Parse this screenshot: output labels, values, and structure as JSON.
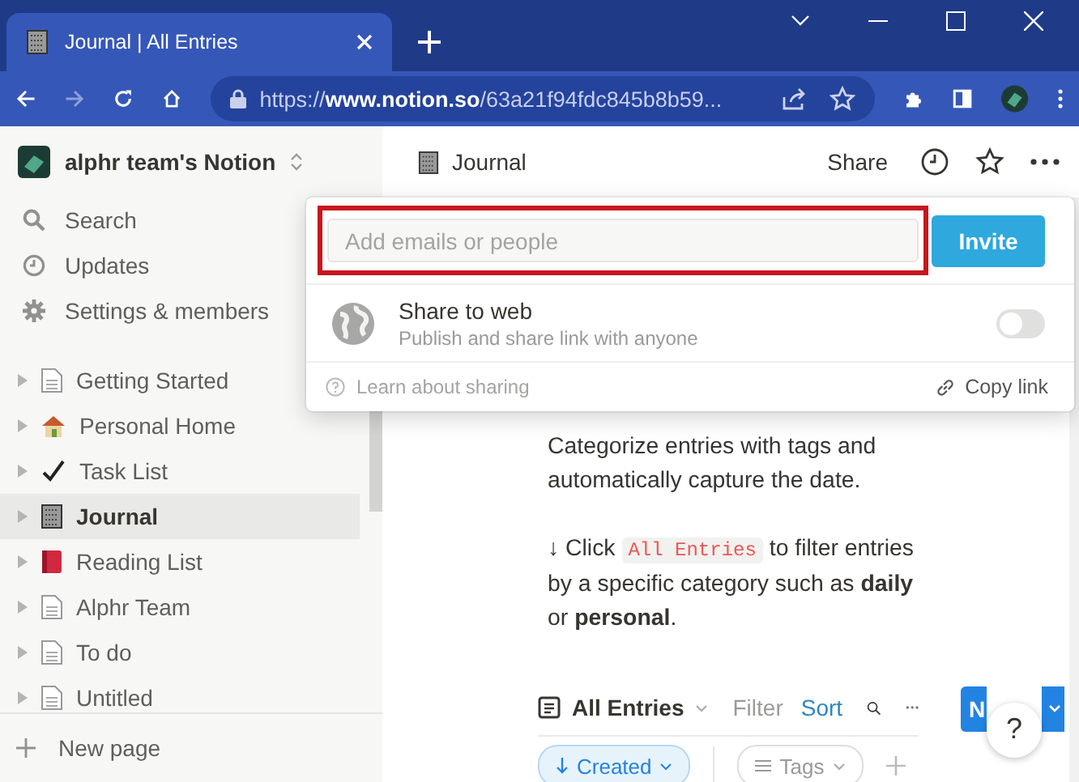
{
  "browser": {
    "tab": {
      "title": "Journal | All Entries"
    },
    "address": {
      "scheme": "https://",
      "host": "www.notion.so",
      "path": "/63a21f94fdc845b8b59..."
    }
  },
  "sidebar": {
    "workspace": "alphr team's Notion",
    "nav": [
      {
        "label": "Search",
        "kind": "search"
      },
      {
        "label": "Updates",
        "kind": "clock"
      },
      {
        "label": "Settings & members",
        "kind": "gear"
      }
    ],
    "pages": [
      {
        "label": "Getting Started",
        "kind": "doc",
        "selected": false
      },
      {
        "label": "Personal Home",
        "kind": "house",
        "selected": false
      },
      {
        "label": "Task List",
        "kind": "check",
        "selected": false
      },
      {
        "label": "Journal",
        "kind": "notebook",
        "selected": true
      },
      {
        "label": "Reading List",
        "kind": "book",
        "selected": false
      },
      {
        "label": "Alphr Team",
        "kind": "doc",
        "selected": false
      },
      {
        "label": "To do",
        "kind": "doc",
        "selected": false
      },
      {
        "label": "Untitled",
        "kind": "doc",
        "selected": false
      }
    ],
    "new_page": "New page"
  },
  "topbar": {
    "title": "Journal",
    "share": "Share"
  },
  "share_popup": {
    "placeholder": "Add emails or people",
    "invite": "Invite",
    "web_title": "Share to web",
    "web_subtitle": "Publish and share link with anyone",
    "web_on": false,
    "learn": "Learn about sharing",
    "copy_link": "Copy link"
  },
  "content": {
    "paragraph": "Categorize entries with tags and automatically capture the date.",
    "tip": {
      "before": "↓ Click ",
      "code": "All Entries",
      "after": " to filter entries by a specific category such as **daily** or **personal**."
    }
  },
  "database": {
    "view": "All Entries",
    "filter": "Filter",
    "sort": "Sort",
    "new": "N",
    "help": "?",
    "chips": [
      {
        "label": "Created",
        "kind": "sort"
      },
      {
        "label": "Tags",
        "kind": "property"
      }
    ]
  }
}
